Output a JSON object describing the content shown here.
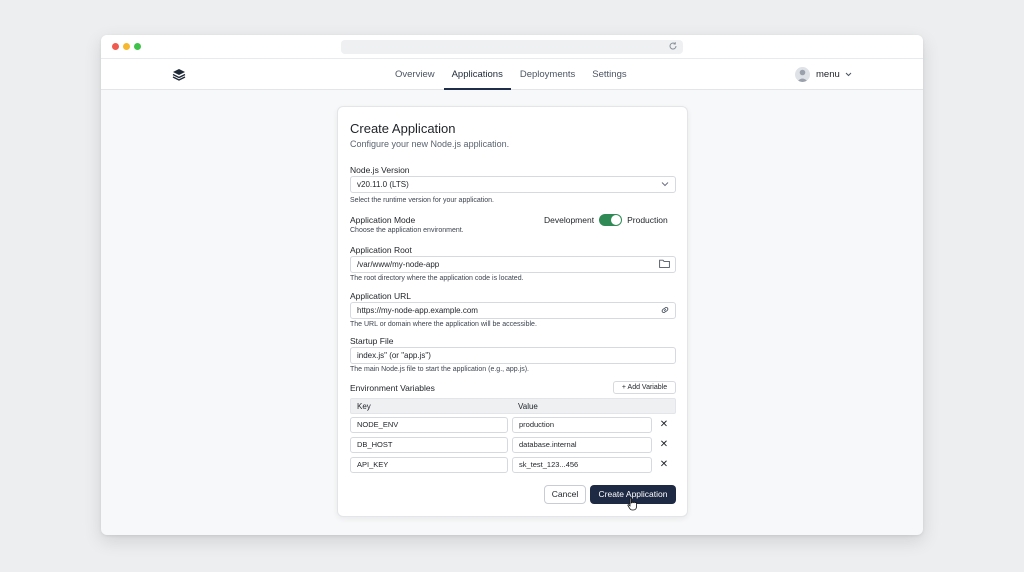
{
  "browser": {
    "reload_icon": "reload-icon"
  },
  "nav": {
    "logo_icon": "stack-layers-icon",
    "tabs": [
      {
        "label": "Overview",
        "active": false
      },
      {
        "label": "Applications",
        "active": true
      },
      {
        "label": "Deployments",
        "active": false
      },
      {
        "label": "Settings",
        "active": false
      }
    ],
    "user_label": "menu"
  },
  "form": {
    "title": "Create Application",
    "subtitle": "Configure your new Node.js application.",
    "node_version": {
      "label": "Node.js Version",
      "value": "v20.11.0 (LTS)",
      "help": "Select the runtime version for your application."
    },
    "mode": {
      "label": "Application Mode",
      "help": "Choose the application environment.",
      "option_left": "Development",
      "option_right": "Production",
      "selected": "Production"
    },
    "app_root": {
      "label": "Application Root",
      "value": "/var/www/my-node-app",
      "help": "The root directory where the application code is located."
    },
    "app_url": {
      "label": "Application URL",
      "value": "https://my-node-app.example.com",
      "help": "The URL or domain where the application will be accessible."
    },
    "startup": {
      "label": "Startup File",
      "value": "index.js\" (or \"app.js\")",
      "help": "The main Node.js file to start the application (e.g., app.js)."
    },
    "env": {
      "label": "Environment Variables",
      "add_label": "+ Add Variable",
      "col_key": "Key",
      "col_value": "Value",
      "rows": [
        {
          "key": "NODE_ENV",
          "value": "production"
        },
        {
          "key": "DB_HOST",
          "value": "database.internal"
        },
        {
          "key": "API_KEY",
          "value": "sk_test_123...456"
        }
      ]
    },
    "cancel_label": "Cancel",
    "create_label": "Create Application"
  },
  "colors": {
    "primary_button": "#1e2a44",
    "toggle_on": "#2f8a55"
  }
}
